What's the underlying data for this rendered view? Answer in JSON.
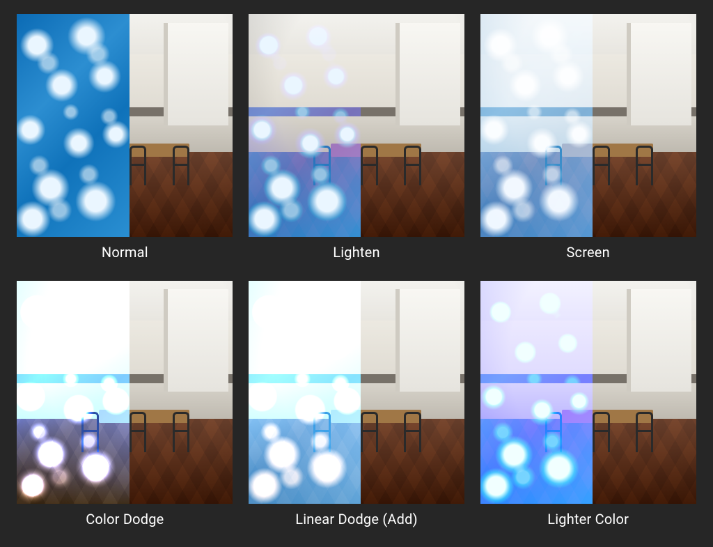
{
  "modes": [
    {
      "key": "normal",
      "label": "Normal",
      "class": "m-normal"
    },
    {
      "key": "lighten",
      "label": "Lighten",
      "class": "m-lighten"
    },
    {
      "key": "screen",
      "label": "Screen",
      "class": "m-screen"
    },
    {
      "key": "color-dodge",
      "label": "Color Dodge",
      "class": "m-color-dodge"
    },
    {
      "key": "linear-dodge",
      "label": "Linear Dodge (Add)",
      "class": "m-linear-dodge"
    },
    {
      "key": "lighter-color",
      "label": "Lighter Color",
      "class": "m-lighter-color"
    }
  ]
}
